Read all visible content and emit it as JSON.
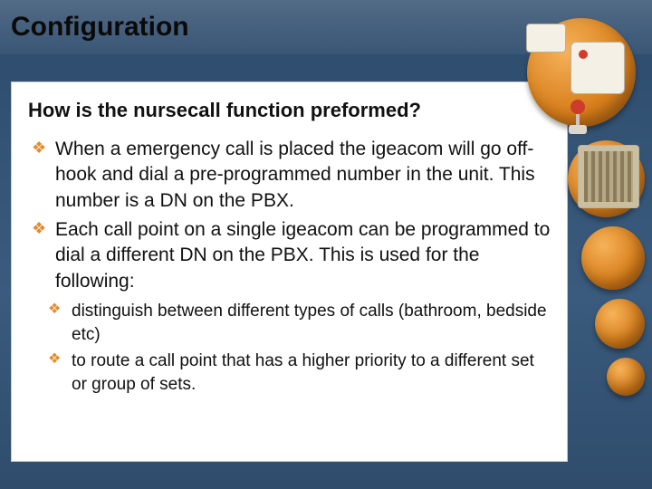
{
  "title": "Configuration",
  "subheading": "How is the nursecall function preformed?",
  "bullets": {
    "l1": [
      " When a emergency call is placed the igeacom will go off-hook and dial a pre-programmed number in the unit.   This number is a DN on the PBX.",
      "Each call point on a single igeacom can be programmed to dial a different DN on the PBX.  This is used for the following:"
    ],
    "l2": [
      " distinguish between different types of calls (bathroom, bedside etc)",
      " to route a call point that has a higher priority to a different set or group of sets."
    ]
  }
}
